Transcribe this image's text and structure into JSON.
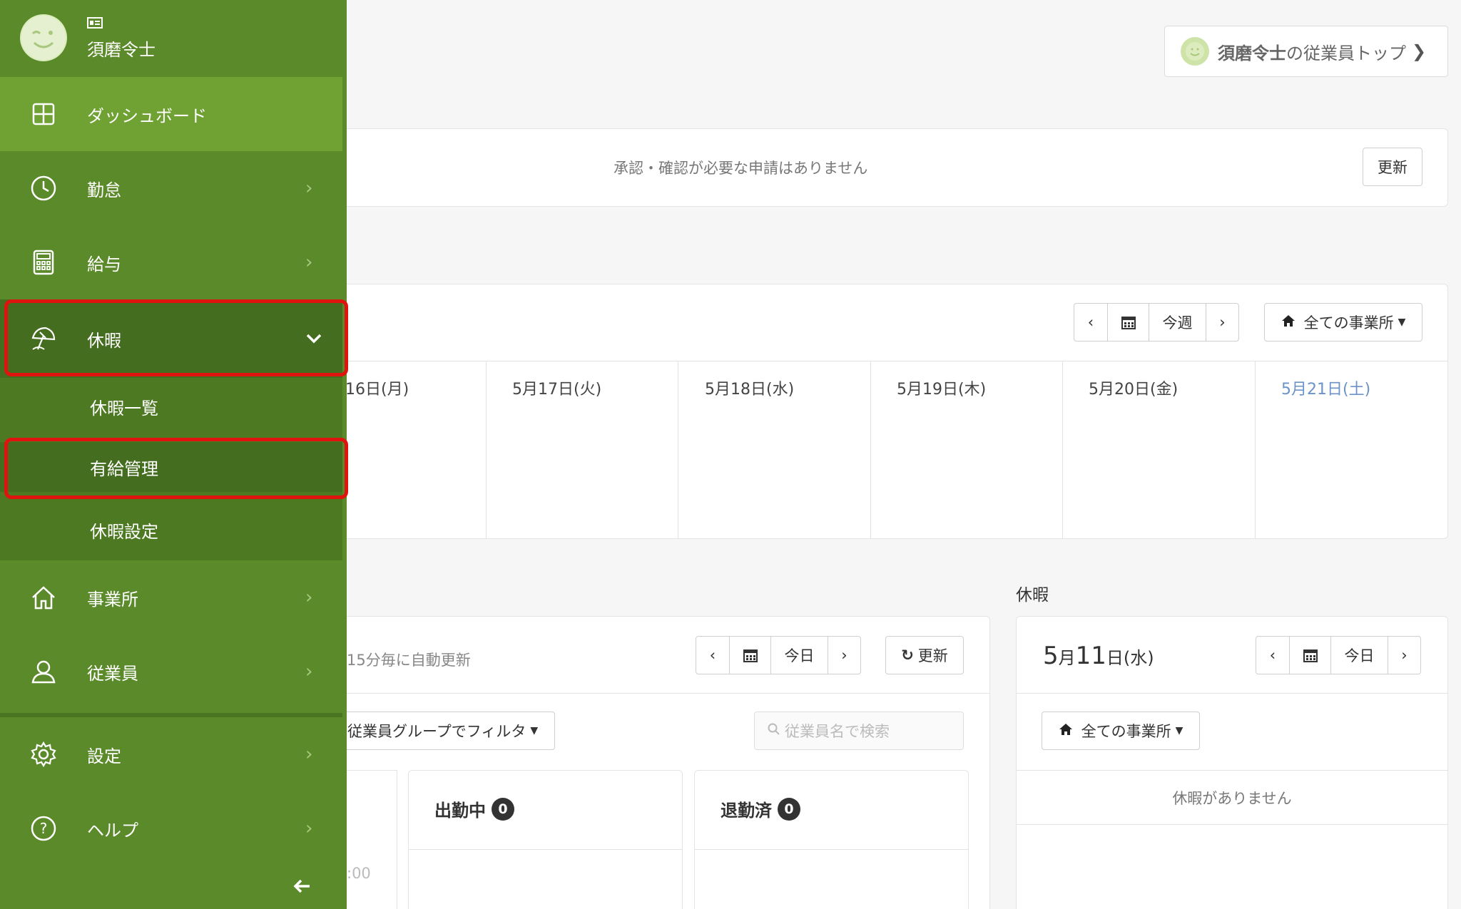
{
  "header": {
    "top_link_name": "須磨令士",
    "top_link_suffix": "の従業員トップ"
  },
  "approval": {
    "message": "承認・確認が必要な申請はありません",
    "refresh_label": "更新"
  },
  "week": {
    "today_label": "今週",
    "office_label": "全ての事業所",
    "days": [
      "16日(月)",
      "5月17日(火)",
      "5月18日(水)",
      "5月19日(木)",
      "5月20日(金)",
      "5月21日(土)"
    ],
    "saturday_color": "#6b93c7"
  },
  "attendance": {
    "auto_update": "15分毎に自動更新",
    "today_label": "今日",
    "refresh_label": "更新",
    "group_filter": "従業員グループでフィルタ",
    "search_placeholder": "従業員名で検索",
    "col_working": "出勤中",
    "col_working_count": "0",
    "col_left": "退勤済",
    "col_left_count": "0",
    "partial_time": ":00"
  },
  "leave": {
    "section_title": "休暇",
    "date_month": "5",
    "date_month_unit": "月",
    "date_day": "11",
    "date_day_unit": "日",
    "date_weekday": "(水)",
    "today_label": "今日",
    "office_label": "全ての事業所",
    "empty_message": "休暇がありません"
  },
  "sidebar": {
    "user_name": "須磨令士",
    "items": {
      "dashboard": "ダッシュボード",
      "attendance": "勤怠",
      "payroll": "給与",
      "leave": "休暇",
      "leave_list": "休暇一覧",
      "paid_leave": "有給管理",
      "leave_settings": "休暇設定",
      "office": "事業所",
      "employee": "従業員",
      "settings": "設定",
      "help": "ヘルプ"
    },
    "colors": {
      "base": "#5b8a2a",
      "active": "#6fa233",
      "dark": "#456d1f",
      "highlight": "#e0140f"
    }
  }
}
